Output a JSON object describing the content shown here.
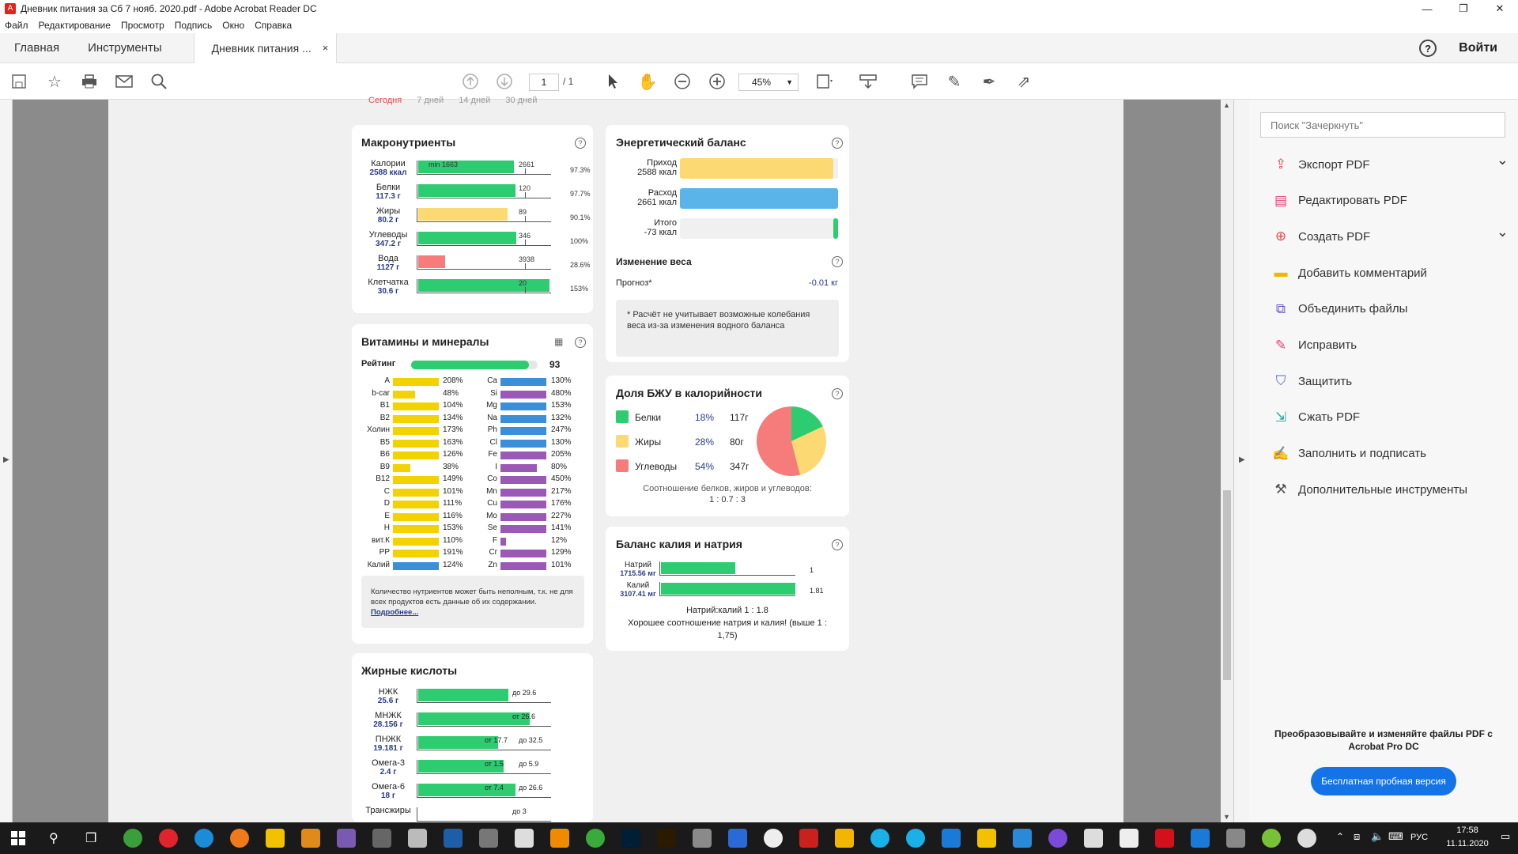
{
  "window": {
    "title": "Дневник питания за Сб 7 нояб. 2020.pdf - Adobe Acrobat Reader DC",
    "minimize": "—",
    "maximize": "❐",
    "close": "✕"
  },
  "menu": [
    "Файл",
    "Редактирование",
    "Просмотр",
    "Подпись",
    "Окно",
    "Справка"
  ],
  "tabs": {
    "home": "Главная",
    "tools": "Инструменты",
    "document": "Дневник питания ...",
    "close": "×",
    "help": "?",
    "login": "Войти"
  },
  "toolbar": {
    "page_current": "1",
    "page_total": "/ 1",
    "zoom": "45%"
  },
  "periods": [
    "Сегодня",
    "7 дней",
    "14 дней",
    "30 дней"
  ],
  "macro": {
    "title": "Макронутриенты",
    "rows": [
      {
        "name": "Калории",
        "value": "2588 ккал",
        "fill": 0.72,
        "color": "#2ecc71",
        "min_label": "min 1663",
        "target": "2661",
        "pct": "97.3%"
      },
      {
        "name": "Белки",
        "value": "117.3 г",
        "fill": 0.73,
        "color": "#2ecc71",
        "target": "120",
        "pct": "97.7%"
      },
      {
        "name": "Жиры",
        "value": "80.2 г",
        "fill": 0.67,
        "color": "#fcd972",
        "target": "89",
        "pct": "90.1%"
      },
      {
        "name": "Углеводы",
        "value": "347.2 г",
        "fill": 0.74,
        "color": "#2ecc71",
        "target": "346",
        "pct": "100%"
      },
      {
        "name": "Вода",
        "value": "1127 г",
        "fill": 0.2,
        "color": "#f67b7b",
        "target": "3938",
        "pct": "28.6%"
      },
      {
        "name": "Клетчатка",
        "value": "30.6 г",
        "fill": 0.99,
        "color": "#2ecc71",
        "target": "20",
        "pct": "153%"
      }
    ]
  },
  "energy": {
    "title": "Энергетический баланс",
    "rows": [
      {
        "label": "Приход",
        "value": "2588 ккал",
        "fill": 0.97,
        "color": "#fcd972"
      },
      {
        "label": "Расход",
        "value": "2661 ккал",
        "fill": 1.0,
        "color": "#5ab4ea"
      },
      {
        "label": "Итого",
        "value": "-73 ккал",
        "fill": 0.03,
        "color": "#2ecc71"
      }
    ],
    "weight_title": "Изменение веса",
    "forecast_label": "Прогноз*",
    "forecast_value": "-0.01 кг",
    "note": "* Расчёт не учитывает возможные колебания веса из-за изменения водного баланса"
  },
  "vitamins": {
    "title": "Витамины и минералы",
    "rating_label": "Рейтинг",
    "rating_value": "93",
    "rating_fill": 0.93,
    "left": [
      {
        "name": "A",
        "pct": "208%",
        "fill": 1.0,
        "color": "#f2d300"
      },
      {
        "name": "b-car",
        "pct": "48%",
        "fill": 0.48,
        "color": "#f2d300"
      },
      {
        "name": "B1",
        "pct": "104%",
        "fill": 1.0,
        "color": "#f2d300"
      },
      {
        "name": "B2",
        "pct": "134%",
        "fill": 1.0,
        "color": "#f2d300"
      },
      {
        "name": "Холин",
        "pct": "173%",
        "fill": 1.0,
        "color": "#f2d300"
      },
      {
        "name": "B5",
        "pct": "163%",
        "fill": 1.0,
        "color": "#f2d300"
      },
      {
        "name": "B6",
        "pct": "126%",
        "fill": 1.0,
        "color": "#f2d300"
      },
      {
        "name": "B9",
        "pct": "38%",
        "fill": 0.38,
        "color": "#f2d300"
      },
      {
        "name": "B12",
        "pct": "149%",
        "fill": 1.0,
        "color": "#f2d300"
      },
      {
        "name": "C",
        "pct": "101%",
        "fill": 1.0,
        "color": "#f2d300"
      },
      {
        "name": "D",
        "pct": "111%",
        "fill": 1.0,
        "color": "#f2d300"
      },
      {
        "name": "E",
        "pct": "116%",
        "fill": 1.0,
        "color": "#f2d300"
      },
      {
        "name": "H",
        "pct": "153%",
        "fill": 1.0,
        "color": "#f2d300"
      },
      {
        "name": "вит.К",
        "pct": "110%",
        "fill": 1.0,
        "color": "#f2d300"
      },
      {
        "name": "PP",
        "pct": "191%",
        "fill": 1.0,
        "color": "#f2d300"
      },
      {
        "name": "Калий",
        "pct": "124%",
        "fill": 1.0,
        "color": "#3a8fd8"
      }
    ],
    "right": [
      {
        "name": "Ca",
        "pct": "130%",
        "fill": 1.0,
        "color": "#3a8fd8"
      },
      {
        "name": "Si",
        "pct": "480%",
        "fill": 1.0,
        "color": "#9b59b6"
      },
      {
        "name": "Mg",
        "pct": "153%",
        "fill": 1.0,
        "color": "#3a8fd8"
      },
      {
        "name": "Na",
        "pct": "132%",
        "fill": 1.0,
        "color": "#3a8fd8"
      },
      {
        "name": "Ph",
        "pct": "247%",
        "fill": 1.0,
        "color": "#3a8fd8"
      },
      {
        "name": "Cl",
        "pct": "130%",
        "fill": 1.0,
        "color": "#3a8fd8"
      },
      {
        "name": "Fe",
        "pct": "205%",
        "fill": 1.0,
        "color": "#9b59b6"
      },
      {
        "name": "I",
        "pct": "80%",
        "fill": 0.8,
        "color": "#9b59b6"
      },
      {
        "name": "Co",
        "pct": "450%",
        "fill": 1.0,
        "color": "#9b59b6"
      },
      {
        "name": "Mn",
        "pct": "217%",
        "fill": 1.0,
        "color": "#9b59b6"
      },
      {
        "name": "Cu",
        "pct": "176%",
        "fill": 1.0,
        "color": "#9b59b6"
      },
      {
        "name": "Mo",
        "pct": "227%",
        "fill": 1.0,
        "color": "#9b59b6"
      },
      {
        "name": "Se",
        "pct": "141%",
        "fill": 1.0,
        "color": "#9b59b6"
      },
      {
        "name": "F",
        "pct": "12%",
        "fill": 0.12,
        "color": "#9b59b6"
      },
      {
        "name": "Cr",
        "pct": "129%",
        "fill": 1.0,
        "color": "#9b59b6"
      },
      {
        "name": "Zn",
        "pct": "101%",
        "fill": 1.0,
        "color": "#9b59b6"
      }
    ],
    "note": "Количество нутриентов может быть неполным, т.к. не для всех продуктов есть данные об их содержании.",
    "more_link": "Подробнее..."
  },
  "bju": {
    "title": "Доля БЖУ в калорийности",
    "rows": [
      {
        "name": "Белки",
        "pct": "18%",
        "grams": "117г",
        "color": "#2ecc71",
        "share": 18
      },
      {
        "name": "Жиры",
        "pct": "28%",
        "grams": "80г",
        "color": "#fcd972",
        "share": 28
      },
      {
        "name": "Углеводы",
        "pct": "54%",
        "grams": "347г",
        "color": "#f67b7b",
        "share": 54
      }
    ],
    "ratio_label": "Соотношение белков, жиров и углеводов:",
    "ratio_value": "1 : 0.7 : 3"
  },
  "potassium": {
    "title": "Баланс калия и натрия",
    "rows": [
      {
        "name": "Натрий",
        "value": "1715.56 мг",
        "fill": 0.55,
        "right": "1"
      },
      {
        "name": "Калий",
        "value": "3107.41 мг",
        "fill": 1.0,
        "right": "1.81"
      }
    ],
    "ratio": "Натрий:калий 1 : 1.8",
    "comment": "Хорошее соотношение натрия и калия! (выше 1 : 1,75)"
  },
  "fatty": {
    "title": "Жирные кислоты",
    "rows": [
      {
        "name": "НЖК",
        "value": "25.6 г",
        "fill": 0.68,
        "labels": [
          "до 29.6"
        ]
      },
      {
        "name": "МНЖК",
        "value": "28.156 г",
        "fill": 0.84,
        "labels": [
          "от 26.6"
        ]
      },
      {
        "name": "ПНЖК",
        "value": "19.181 г",
        "fill": 0.6,
        "labels": [
          "от 17.7",
          "до 32.5"
        ]
      },
      {
        "name": "Омега-3",
        "value": "2.4 г",
        "fill": 0.64,
        "labels": [
          "от 1.5",
          "до 5.9"
        ]
      },
      {
        "name": "Омега-6",
        "value": "18 г",
        "fill": 0.73,
        "labels": [
          "от 7.4",
          "до 26.6"
        ]
      },
      {
        "name": "Трансжиры",
        "value": "",
        "fill": 0,
        "labels": [
          "до 3"
        ]
      }
    ]
  },
  "rightpane": {
    "search_placeholder": "Поиск \"Зачеркнуть\"",
    "tools": [
      {
        "label": "Экспорт PDF",
        "icon": "export-pdf-icon",
        "color": "#e34c4c",
        "glyph": "⇪",
        "expand": "⌄"
      },
      {
        "label": "Редактировать PDF",
        "icon": "edit-pdf-icon",
        "color": "#e2437c",
        "glyph": "▤",
        "expand": ""
      },
      {
        "label": "Создать PDF",
        "icon": "create-pdf-icon",
        "color": "#e34c4c",
        "glyph": "⊕",
        "expand": "⌄"
      },
      {
        "label": "Добавить комментарий",
        "icon": "comment-icon",
        "color": "#f2b600",
        "glyph": "▬",
        "expand": ""
      },
      {
        "label": "Объединить файлы",
        "icon": "combine-files-icon",
        "color": "#6a5acd",
        "glyph": "⧉",
        "expand": ""
      },
      {
        "label": "Исправить",
        "icon": "redact-icon",
        "color": "#e2437c",
        "glyph": "✎",
        "expand": ""
      },
      {
        "label": "Защитить",
        "icon": "protect-icon",
        "color": "#5a6acd",
        "glyph": "⛉",
        "expand": ""
      },
      {
        "label": "Сжать PDF",
        "icon": "compress-pdf-icon",
        "color": "#2aa198",
        "glyph": "⇲",
        "expand": ""
      },
      {
        "label": "Заполнить и подписать",
        "icon": "fill-sign-icon",
        "color": "#8a4acd",
        "glyph": "✍",
        "expand": ""
      },
      {
        "label": "Дополнительные инструменты",
        "icon": "more-tools-icon",
        "color": "#555555",
        "glyph": "⚒",
        "expand": ""
      }
    ],
    "promo": "Преобразовывайте и изменяйте файлы PDF с Acrobat Pro DC",
    "promo_button": "Бесплатная пробная версия"
  },
  "taskbar": {
    "lang": "РУС",
    "time": "17:58",
    "date": "11.11.2020"
  }
}
